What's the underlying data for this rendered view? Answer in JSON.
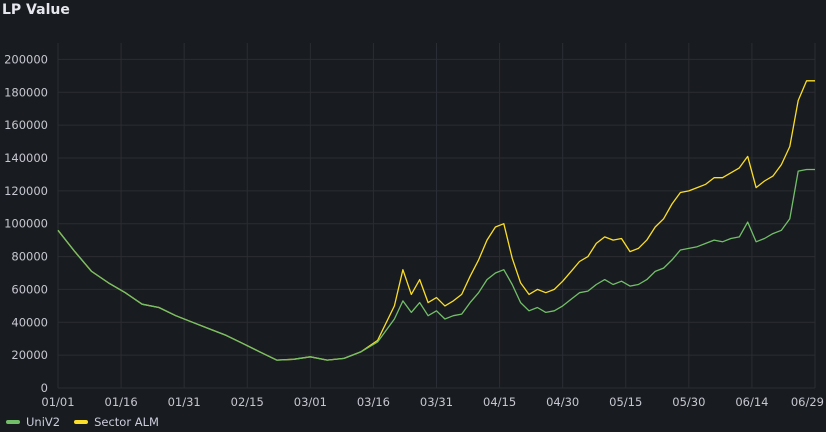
{
  "panel": {
    "title": "LP Value"
  },
  "colors": {
    "univ2": "#73bf69",
    "sector_alm": "#fade2a",
    "grid": "#2a2d33",
    "background": "#181b1f"
  },
  "chart_data": {
    "type": "line",
    "title": "LP Value",
    "grid": true,
    "legend_position": "bottom-left",
    "ylim": [
      0,
      210000
    ],
    "y_ticks": [
      0,
      20000,
      40000,
      60000,
      80000,
      100000,
      120000,
      140000,
      160000,
      180000,
      200000
    ],
    "y_tick_labels": [
      "0",
      "20000",
      "40000",
      "60000",
      "80000",
      "100000",
      "120000",
      "140000",
      "160000",
      "180000",
      "200000"
    ],
    "x_ticks": [
      "01/01",
      "01/16",
      "01/31",
      "02/15",
      "03/01",
      "03/16",
      "03/31",
      "04/15",
      "04/30",
      "05/15",
      "05/30",
      "06/14",
      "06/29"
    ],
    "x": [
      "01/01",
      "01/05",
      "01/09",
      "01/13",
      "01/17",
      "01/21",
      "01/25",
      "01/29",
      "02/02",
      "02/06",
      "02/10",
      "02/14",
      "02/18",
      "02/22",
      "02/26",
      "03/01",
      "03/05",
      "03/09",
      "03/13",
      "03/17",
      "03/21",
      "03/23",
      "03/25",
      "03/27",
      "03/29",
      "03/31",
      "04/02",
      "04/04",
      "04/06",
      "04/08",
      "04/10",
      "04/12",
      "04/14",
      "04/16",
      "04/18",
      "04/20",
      "04/22",
      "04/24",
      "04/26",
      "04/28",
      "04/30",
      "05/02",
      "05/04",
      "05/06",
      "05/08",
      "05/10",
      "05/12",
      "05/14",
      "05/16",
      "05/18",
      "05/20",
      "05/22",
      "05/24",
      "05/26",
      "05/28",
      "05/30",
      "06/01",
      "06/03",
      "06/05",
      "06/07",
      "06/09",
      "06/11",
      "06/13",
      "06/15",
      "06/17",
      "06/19",
      "06/21",
      "06/23",
      "06/25",
      "06/27",
      "06/29"
    ],
    "series": [
      {
        "name": "UniV2",
        "color": "#73bf69",
        "values": [
          96000,
          83000,
          71000,
          64000,
          58000,
          51000,
          49000,
          44000,
          40000,
          36000,
          32000,
          27000,
          22000,
          17000,
          17500,
          19000,
          17000,
          18000,
          22000,
          28000,
          42000,
          53000,
          46000,
          52000,
          44000,
          47000,
          42000,
          44000,
          45000,
          52000,
          58000,
          66000,
          70000,
          72000,
          63000,
          52000,
          47000,
          49000,
          46000,
          47000,
          50000,
          54000,
          58000,
          59000,
          63000,
          66000,
          63000,
          65000,
          62000,
          63000,
          66000,
          71000,
          73000,
          78000,
          84000,
          85000,
          86000,
          88000,
          90000,
          89000,
          91000,
          92000,
          101000,
          89000,
          91000,
          94000,
          96000,
          103000,
          132000,
          133000,
          133000
        ]
      },
      {
        "name": "Sector ALM",
        "color": "#fade2a",
        "values": [
          96000,
          83000,
          71000,
          64000,
          58000,
          51000,
          49000,
          44000,
          40000,
          36000,
          32000,
          27000,
          22000,
          17000,
          17500,
          19000,
          17000,
          18000,
          22000,
          29000,
          50000,
          72000,
          57000,
          66000,
          52000,
          55000,
          50000,
          53000,
          57000,
          68000,
          78000,
          90000,
          98000,
          100000,
          79000,
          64000,
          57000,
          60000,
          58000,
          60000,
          65000,
          71000,
          77000,
          80000,
          88000,
          92000,
          90000,
          91000,
          83000,
          85000,
          90000,
          98000,
          103000,
          112000,
          119000,
          120000,
          122000,
          124000,
          128000,
          128000,
          131000,
          134000,
          141000,
          122000,
          126000,
          129000,
          136000,
          147000,
          175000,
          187000,
          187000
        ]
      }
    ]
  }
}
